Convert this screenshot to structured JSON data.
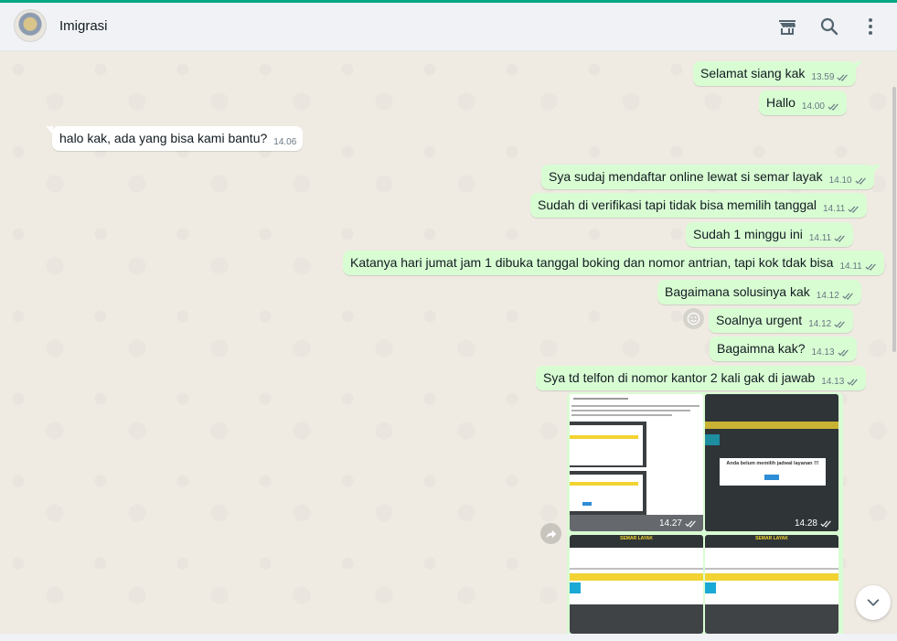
{
  "header": {
    "contact_name": "Imigrasi",
    "icons": [
      "catalog-store-icon",
      "search-icon",
      "menu-dots-icon"
    ]
  },
  "messages": [
    {
      "dir": "out",
      "text": "Selamat siang kak",
      "time": "13.59"
    },
    {
      "dir": "out",
      "text": "Hallo",
      "time": "14.00"
    },
    {
      "dir": "in",
      "text": "halo kak, ada yang bisa kami bantu?",
      "time": "14.06"
    },
    {
      "dir": "out",
      "text": "Sya sudaj mendaftar online lewat si semar layak",
      "time": "14.10"
    },
    {
      "dir": "out",
      "text": "Sudah di verifikasi tapi tidak bisa memilih tanggal",
      "time": "14.11"
    },
    {
      "dir": "out",
      "text": "Sudah 1 minggu ini",
      "time": "14.11"
    },
    {
      "dir": "out",
      "text": "Katanya hari jumat jam 1 dibuka tanggal boking dan nomor antrian, tapi kok tdak bisa",
      "time": "14.11"
    },
    {
      "dir": "out",
      "text": "Bagaimana solusinya kak",
      "time": "14.12"
    },
    {
      "dir": "out",
      "text": "Soalnya urgent",
      "time": "14.12"
    },
    {
      "dir": "out",
      "text": "Bagaimna kak?",
      "time": "14.13"
    },
    {
      "dir": "out",
      "text": "Sya td telfon di nomor kantor 2 kali gak di jawab",
      "time": "14.13"
    }
  ],
  "album": {
    "photos": [
      {
        "time": "14.27"
      },
      {
        "time": "14.28",
        "dialog_text": "Anda belum memilih jadwal layanan !!!"
      },
      {
        "banner": "SEMAR LAYAK"
      },
      {
        "banner": "SEMAR LAYAK"
      }
    ]
  },
  "colors": {
    "accent": "#00a884",
    "outgoing_bubble": "#d9fdd3",
    "incoming_bubble": "#ffffff",
    "read_tick": "#667781"
  }
}
